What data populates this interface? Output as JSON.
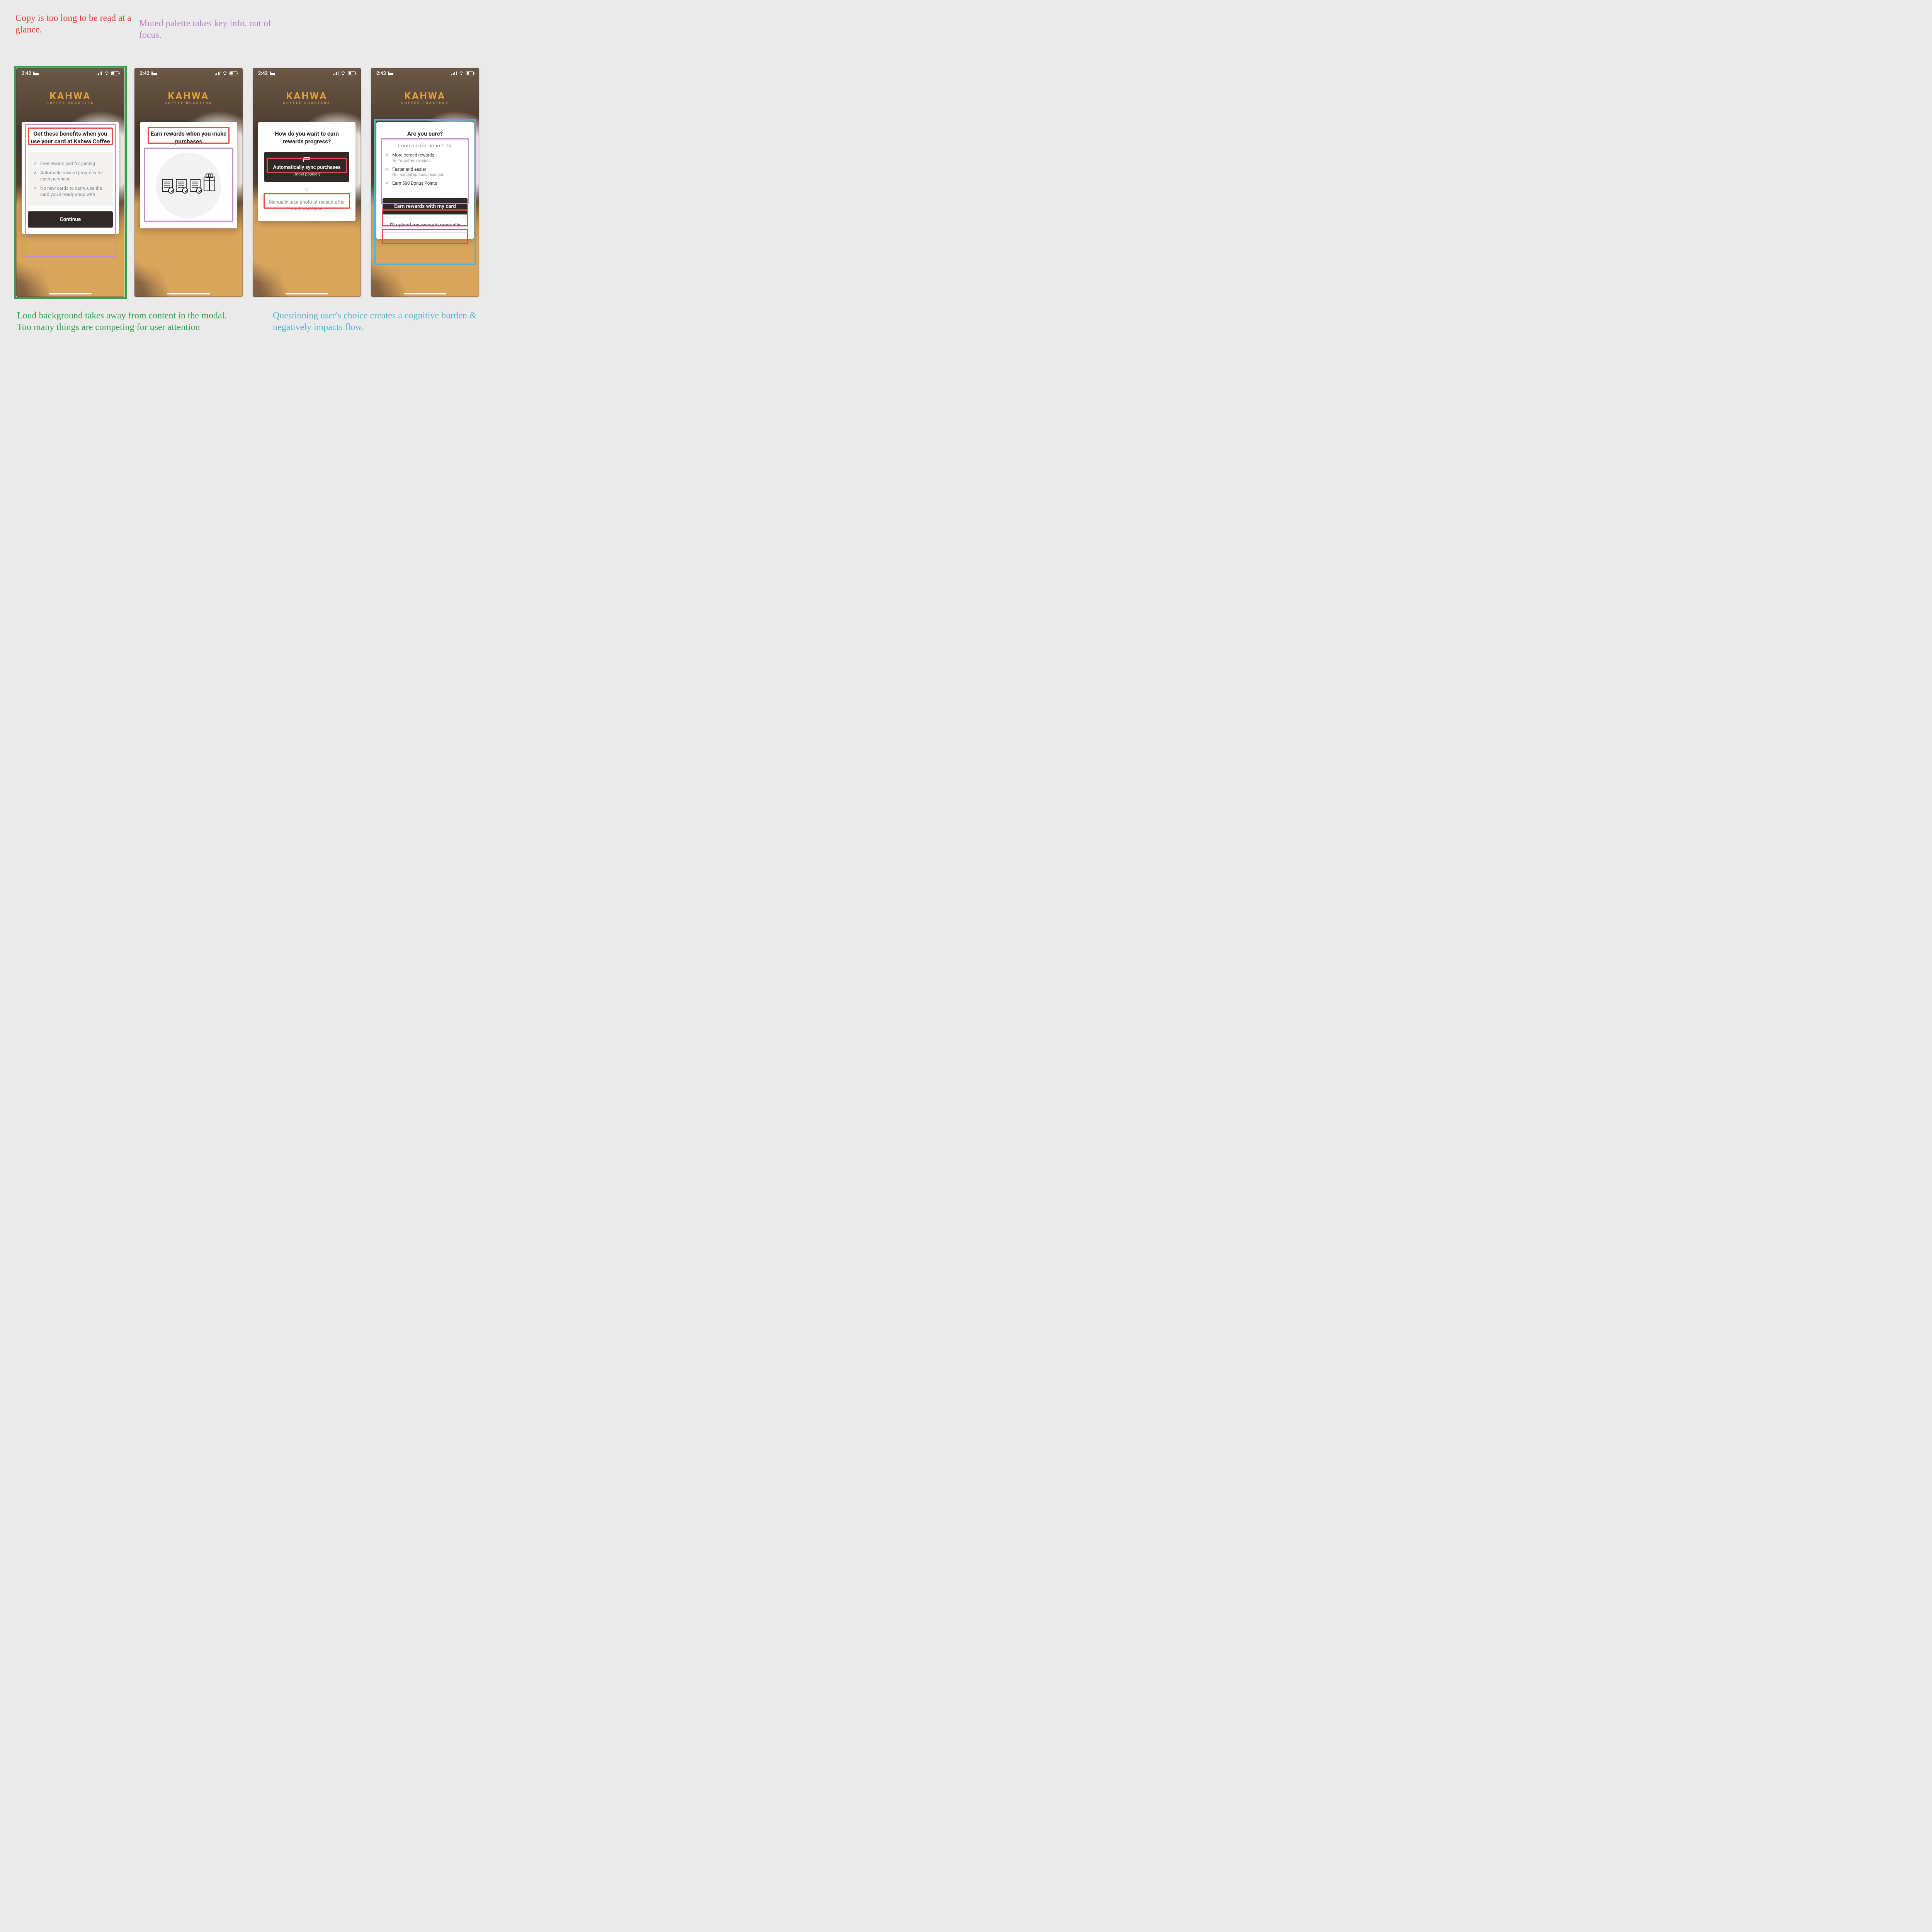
{
  "annotations": {
    "red": "Copy is too long to be read at a glance.",
    "purple": "Muted palette takes key info. out of focus.",
    "green": "Loud background takes away from content in the modal. Too many things are competing for user attention",
    "blue": "Questioning user's choice creates a cognitive burden & negatively impacts flow."
  },
  "brand": {
    "name": "KAHWA",
    "subtitle": "COFFEE ROASTERS"
  },
  "status": {
    "time_a": "2:42",
    "time_b": "2:43"
  },
  "screen1": {
    "title": "Get these benefits when you use your card at Kahwa Coffee",
    "benefits": [
      "Free reward just for joining",
      "Automatic reward progress for each purchase",
      "No new cards to carry, use the card you already shop with"
    ],
    "cta": "Continue"
  },
  "screen2": {
    "title": "Earn rewards when you make purchases"
  },
  "screen3": {
    "title": "How do you want to earn rewards progress?",
    "auto_title": "Automatically sync purchases",
    "auto_sub": "(most popular)",
    "or": "or",
    "manual": "Manually take photo of receipt after each purchase"
  },
  "screen4": {
    "title": "Are you sure?",
    "linked_title": "LINKED CARD BENEFITS",
    "rows": [
      {
        "main": "More earned rewards",
        "sub": "No forgotten receipts"
      },
      {
        "main": "Faster and easier",
        "sub": "No manual uploads required"
      },
      {
        "main": "Earn 500 Bonus Points",
        "sub": ""
      }
    ],
    "primary": "Earn rewards with my card",
    "secondary": "I'll upload my receipts manually"
  }
}
